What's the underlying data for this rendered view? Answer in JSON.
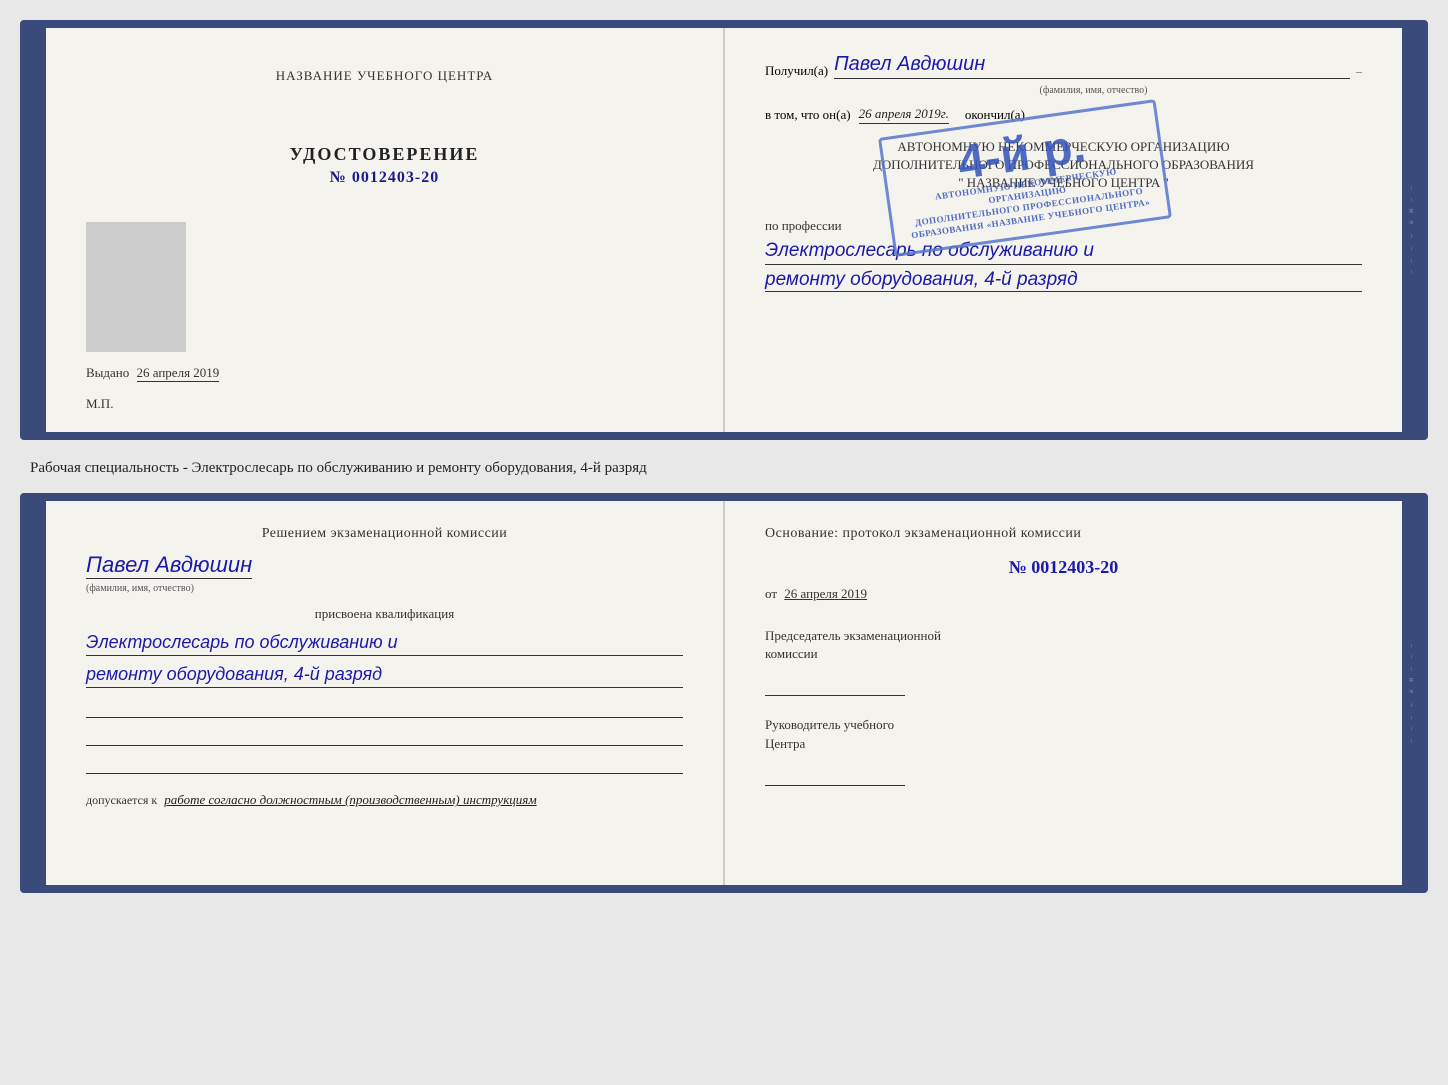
{
  "page": {
    "background": "#e8e8e8"
  },
  "top_cert": {
    "left": {
      "center_title": "НАЗВАНИЕ УЧЕБНОГО ЦЕНТРА",
      "type": "УДОСТОВЕРЕНИЕ",
      "number_label": "№",
      "number_value": "0012403-20",
      "issued_label": "Выдано",
      "issued_date": "26 апреля 2019",
      "mp_label": "М.П."
    },
    "right": {
      "received_label": "Получил(а)",
      "recipient_name": "Павел Авдюшин",
      "name_subtitle": "(фамилия, имя, отчество)",
      "date_prefix": "в том, что он(а)",
      "date_value": "26 апреля 2019г.",
      "finished_label": "окончил(а)",
      "org_line1": "АВТОНОМНУЮ НЕКОММЕРЧЕСКУЮ ОРГАНИЗАЦИЮ",
      "org_line2": "ДОПОЛНИТЕЛЬНОГО ПРОФЕССИОНАЛЬНОГО ОБРАЗОВАНИЯ",
      "org_line3": "\" НАЗВАНИЕ УЧЕБНОГО ЦЕНТРА \"",
      "profession_label": "по профессии",
      "profession_line1": "Электрослесарь по обслуживанию и",
      "profession_line2": "ремонту оборудования, 4-й разряд",
      "stamp_grade": "4-й р.",
      "stamp_org1": "АВТОНОМНУЮ НЕКОММЕРЧЕСКУЮ",
      "stamp_org2": "ОРГАНИЗАЦИЮ",
      "stamp_org3": "ДОПОЛНИТЕЛЬНОГО",
      "stamp_org4": "ПРОФЕССИОНАЛЬНОГО ОБРАЗОВАНИЯ",
      "stamp_org5": "НАЗВАНИЕ УЧЕБНОГО ЦЕНТРА"
    }
  },
  "between_label": "Рабочая специальность - Электрослесарь по обслуживанию и ремонту оборудования, 4-й разряд",
  "bottom_cert": {
    "left": {
      "commission_title": "Решением экзаменационной комиссии",
      "person_name": "Павел Авдюшин",
      "name_subtitle": "(фамилия, имя, отчество)",
      "assigned_label": "присвоена квалификация",
      "qualification_line1": "Электрослесарь по обслуживанию и",
      "qualification_line2": "ремонту оборудования, 4-й разряд",
      "allowed_label": "допускается к",
      "allowed_value": "работе согласно должностным (производственным) инструкциям"
    },
    "right": {
      "basis_title": "Основание: протокол экзаменационной комиссии",
      "protocol_number": "№ 0012403-20",
      "date_prefix": "от",
      "date_value": "26 апреля 2019",
      "chairman_title_line1": "Председатель экзаменационной",
      "chairman_title_line2": "комиссии",
      "director_title_line1": "Руководитель учебного",
      "director_title_line2": "Центра"
    }
  },
  "side_chars": [
    "-",
    "и",
    "а",
    "←",
    "-",
    "-",
    "-"
  ]
}
